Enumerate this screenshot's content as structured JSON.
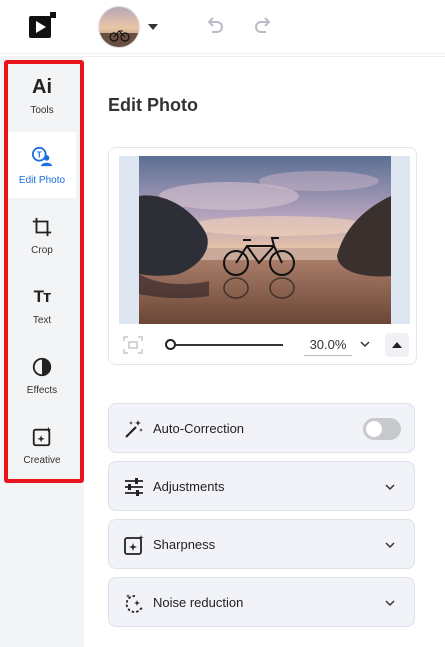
{
  "topbar": {
    "logo_icon": "play-logo-icon",
    "avatar_icon": "user-avatar-photo",
    "undo_icon": "undo-icon",
    "redo_icon": "redo-icon"
  },
  "sidebar": {
    "highlight_color": "#e8141e",
    "items": [
      {
        "label": "Tools",
        "icon": "ai-tools-icon",
        "active": false
      },
      {
        "label": "Edit Photo",
        "icon": "edit-photo-icon",
        "active": true
      },
      {
        "label": "Crop",
        "icon": "crop-icon",
        "active": false
      },
      {
        "label": "Text",
        "icon": "text-icon",
        "active": false
      },
      {
        "label": "Effects",
        "icon": "effects-icon",
        "active": false
      },
      {
        "label": "Creative",
        "icon": "creative-icon",
        "active": false
      }
    ],
    "tools_glyph": "Ai",
    "text_glyph": "Tт"
  },
  "main": {
    "title": "Edit Photo",
    "zoom": {
      "value": "30.0%",
      "slider_fraction": 0.0
    },
    "tools": [
      {
        "label": "Auto-Correction",
        "icon": "magic-wand-icon",
        "control": "toggle",
        "on": false
      },
      {
        "label": "Adjustments",
        "icon": "sliders-icon",
        "control": "chevron"
      },
      {
        "label": "Sharpness",
        "icon": "sharpness-icon",
        "control": "chevron"
      },
      {
        "label": "Noise reduction",
        "icon": "noise-reduction-icon",
        "control": "chevron"
      }
    ]
  },
  "colors": {
    "accent": "#1a6ee0",
    "sidebar_bg": "#f3f4f6",
    "row_bg": "#f1f3f8"
  }
}
